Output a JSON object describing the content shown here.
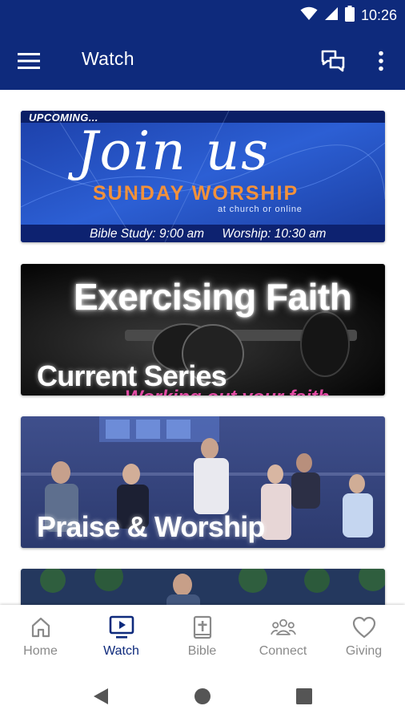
{
  "status_bar": {
    "time": "10:26"
  },
  "app_bar": {
    "title": "Watch"
  },
  "feed": {
    "cards": [
      {
        "kicker": "UPCOMING...",
        "script_title": "Join us",
        "headline": "SUNDAY WORSHIP",
        "subline": "at church or online",
        "schedule": [
          "Bible Study: 9:00 am",
          "Worship: 10:30 am"
        ]
      },
      {
        "title": "Exercising Faith",
        "label": "Current Series",
        "subtitle": "Working out your faith"
      },
      {
        "label": "Praise & Worship"
      },
      {}
    ]
  },
  "bottom_nav": {
    "items": [
      {
        "label": "Home",
        "icon": "home-icon"
      },
      {
        "label": "Watch",
        "icon": "tv-icon",
        "active": true
      },
      {
        "label": "Bible",
        "icon": "bible-icon"
      },
      {
        "label": "Connect",
        "icon": "people-icon"
      },
      {
        "label": "Giving",
        "icon": "heart-icon"
      }
    ]
  },
  "colors": {
    "primary": "#0e2a7c",
    "accent_orange": "#f3913a",
    "inactive": "#8a8a8a",
    "pink": "#e24ba4"
  }
}
